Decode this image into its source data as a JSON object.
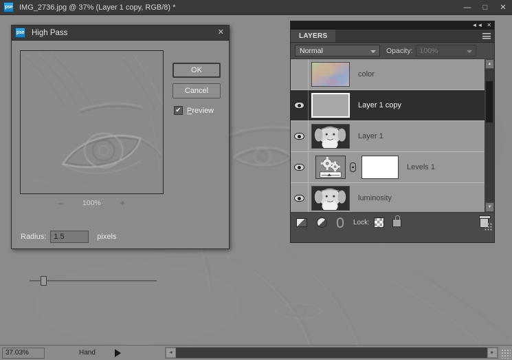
{
  "window": {
    "title": "IMG_2736.jpg @ 37% (Layer 1 copy, RGB/8) *",
    "app_badge": "pse",
    "minimize": "—",
    "maximize": "□",
    "close": "✕"
  },
  "statusbar": {
    "zoom": "37.03%",
    "tool": "Hand"
  },
  "dialog": {
    "title": "High Pass",
    "app_badge": "pse",
    "close": "✕",
    "ok_label": "OK",
    "cancel_label": "Cancel",
    "preview_label_pre": "P",
    "preview_label_post": "review",
    "preview_checked": "✔",
    "zoom_out": "–",
    "zoom_level": "100%",
    "zoom_in": "+",
    "radius_label": "Radius:",
    "radius_value": "1.5",
    "radius_units": "pixels"
  },
  "layers_panel": {
    "tab_label": "LAYERS",
    "collapse_icon": "◄◄",
    "close_icon": "✕",
    "blend_mode": "Normal",
    "opacity_label": "Opacity:",
    "opacity_value": "100%",
    "lock_label": "Lock:",
    "layers": [
      {
        "name": "color",
        "visible": false,
        "selected": false,
        "kind": "color"
      },
      {
        "name": "Layer 1 copy",
        "visible": true,
        "selected": true,
        "kind": "flat"
      },
      {
        "name": "Layer 1",
        "visible": true,
        "selected": false,
        "kind": "photo"
      },
      {
        "name": "Levels 1",
        "visible": true,
        "selected": false,
        "kind": "adjustment"
      },
      {
        "name": "luminosity",
        "visible": true,
        "selected": false,
        "kind": "photo"
      }
    ]
  },
  "colors": {
    "canvas_gray": "#8b8b8b",
    "chrome_dark": "#3a3a3a",
    "panel_gray": "#4a4a4a",
    "list_gray": "#999999",
    "selected_row": "#2e2e2e",
    "accent_blue": "#38a7e0"
  }
}
